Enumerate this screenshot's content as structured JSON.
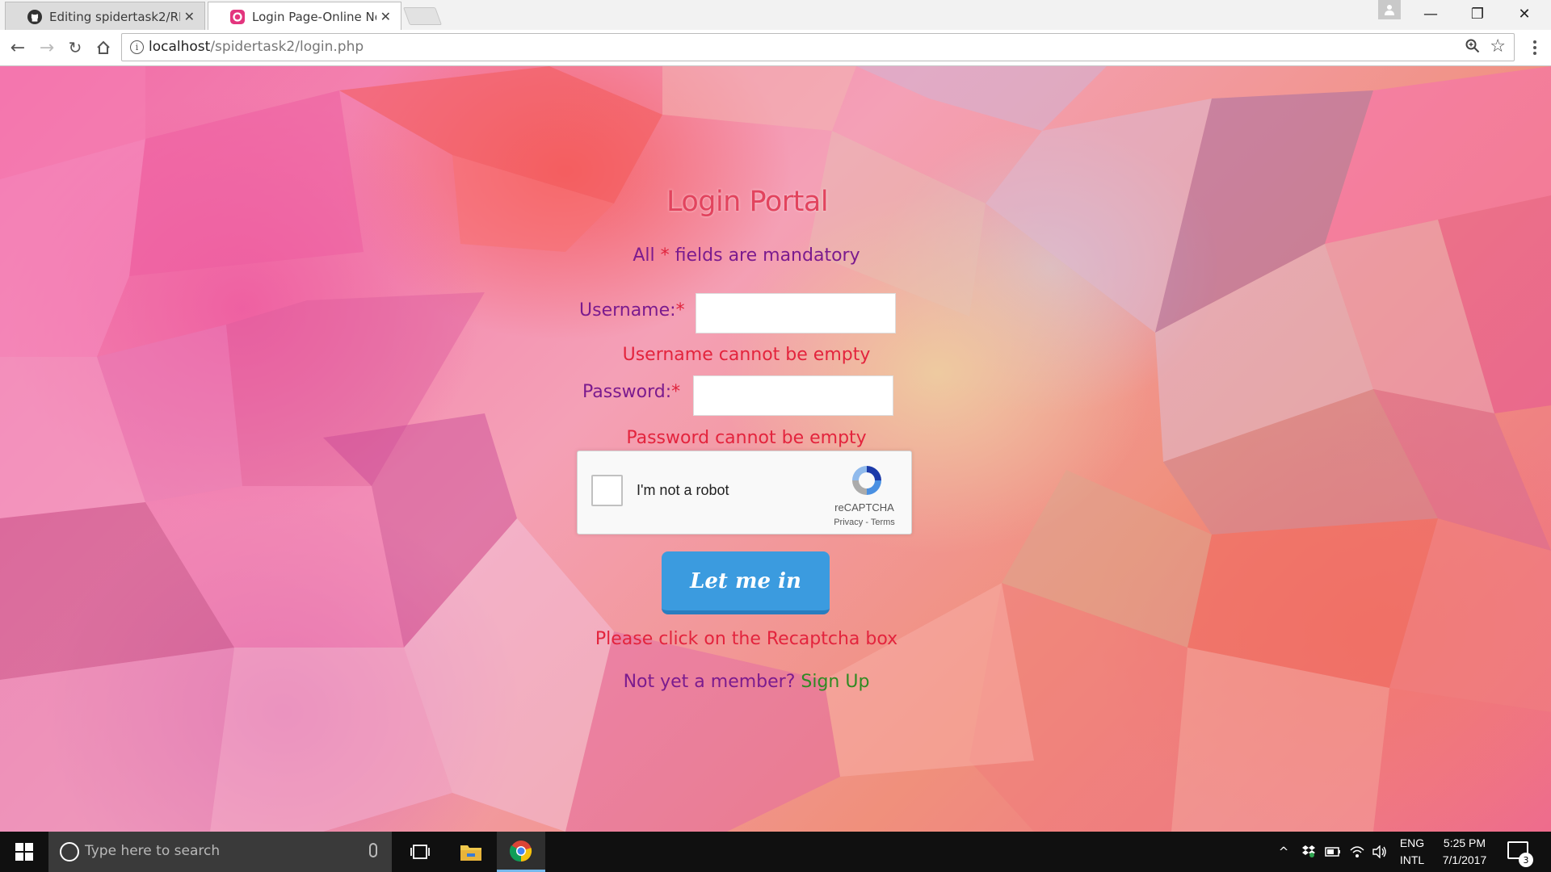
{
  "browser": {
    "tabs": [
      {
        "title": "Editing spidertask2/READ",
        "icon": "github-icon"
      },
      {
        "title": "Login Page-Online Notic",
        "icon": "site-favicon"
      }
    ],
    "url_host": "localhost",
    "url_path": "/spidertask2/login.php",
    "window_controls": {
      "minimize": "—",
      "restore": "❐",
      "close": "✕"
    }
  },
  "page": {
    "title": "Login Portal",
    "mandatory_prefix": "All ",
    "mandatory_star": "*",
    "mandatory_suffix": " fields are mandatory",
    "username_label": "Username:",
    "password_label": "Password:",
    "required_star": "*",
    "username_value": "",
    "password_value": "",
    "username_error": "Username cannot be empty",
    "password_error": "Password cannot be empty",
    "recaptcha": {
      "label": "I'm not a robot",
      "brand": "reCAPTCHA",
      "privacy": "Privacy",
      "terms": "Terms",
      "checked": false
    },
    "submit_label": "Let me in",
    "recaptcha_error": "Please click on the Recaptcha box",
    "signup_prompt": "Not yet a member? ",
    "signup_link": "Sign Up",
    "colors": {
      "title": "#e2445e",
      "label": "#7b1b8e",
      "error": "#e3243d",
      "link": "#2f8a22",
      "button": "#3b9bdf"
    }
  },
  "taskbar": {
    "search_placeholder": "Type here to search",
    "apps": [
      "task-view-icon",
      "file-explorer-icon",
      "chrome-icon"
    ],
    "lang_line1": "ENG",
    "lang_line2": "INTL",
    "time": "5:25 PM",
    "date": "7/1/2017",
    "notification_count": "3"
  }
}
